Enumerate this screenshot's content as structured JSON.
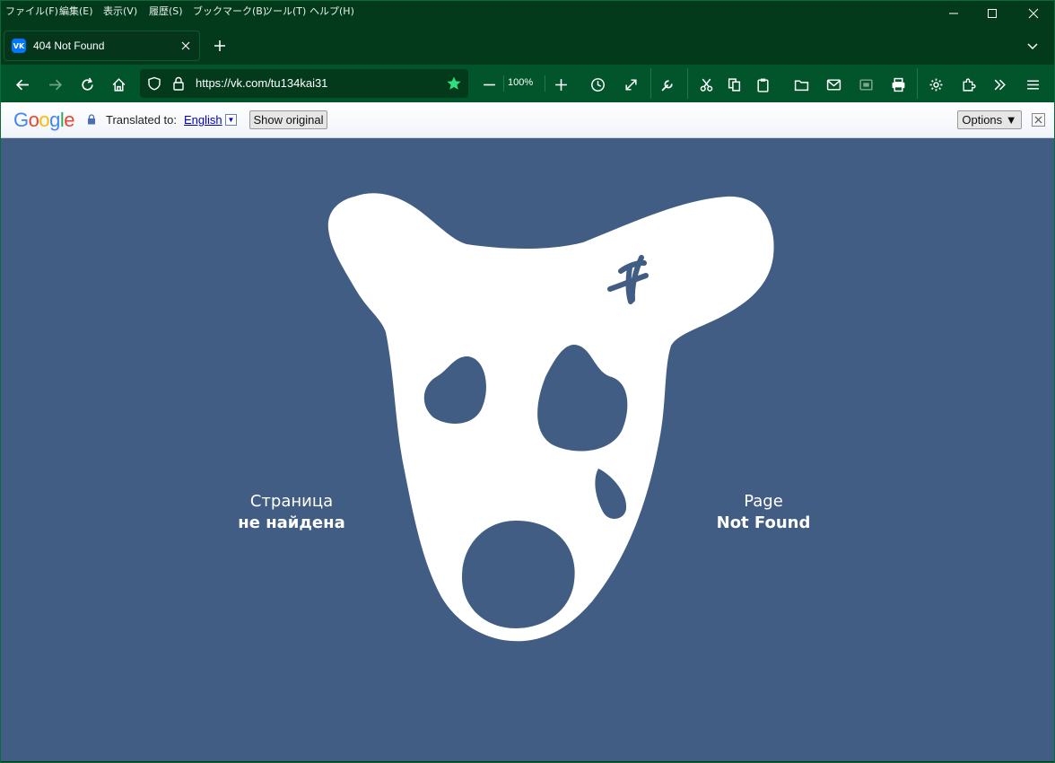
{
  "menubar": {
    "items": [
      "ファイル(F)",
      "編集(E)",
      "表示(V)",
      "履歴(S)",
      "ブックマーク(B)",
      "ツール(T)",
      "ヘルプ(H)"
    ]
  },
  "tab": {
    "favicon_text": "VK",
    "title": "404 Not Found"
  },
  "navbar": {
    "url": "https://vk.com/tu134kai31",
    "zoom": "100%"
  },
  "translate_bar": {
    "logo": "Google",
    "translated_to_label": "Translated to:",
    "language": "English",
    "show_original_label": "Show original",
    "options_label": "Options ▼"
  },
  "page": {
    "left_caption_line1": "Страница",
    "left_caption_line2": "не найдена",
    "right_caption_line1": "Page",
    "right_caption_line2": "Not Found"
  },
  "colors": {
    "chrome_dark": "#043a1c",
    "toolbar": "#02542a",
    "page_background": "#415d83",
    "star": "#2ee07a",
    "vk_blue": "#0077ff"
  }
}
